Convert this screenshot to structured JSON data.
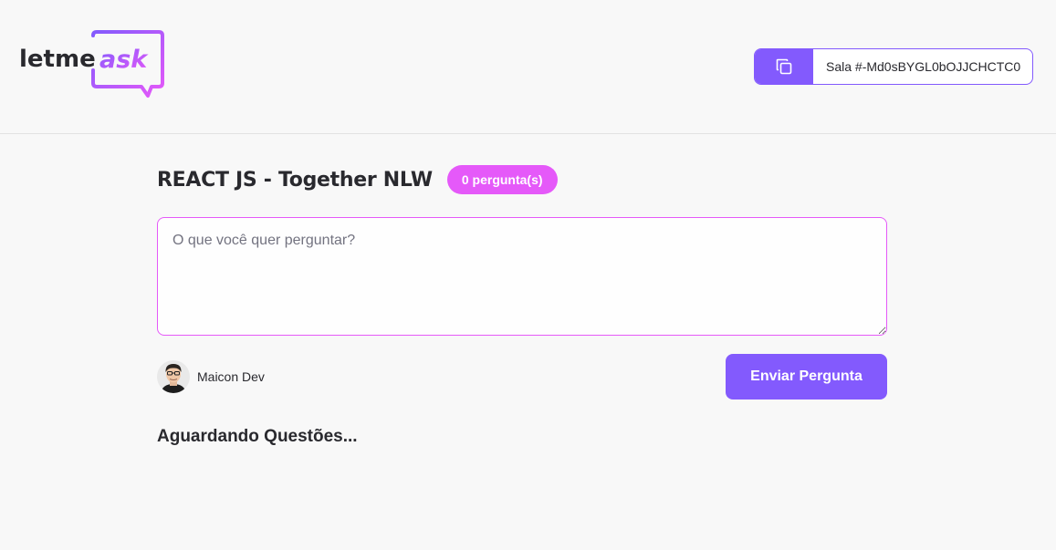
{
  "header": {
    "logo": {
      "text_left": "letme",
      "text_right": "ask"
    },
    "room_code": {
      "label": "Sala #-Md0sBYGL0bOJJCHCTC0",
      "icon": "copy-icon"
    }
  },
  "room": {
    "title": "REACT JS - Together NLW",
    "question_count": "0 pergunta(s)"
  },
  "form": {
    "placeholder": "O que você quer perguntar?",
    "value": "",
    "user_name": "Maicon Dev",
    "submit_label": "Enviar Pergunta"
  },
  "questions": {
    "empty_label": "Aguardando Questões..."
  },
  "colors": {
    "primary": "#835afd",
    "accent": "#e559f9",
    "background": "#f8f8f8",
    "text": "#29292e"
  }
}
